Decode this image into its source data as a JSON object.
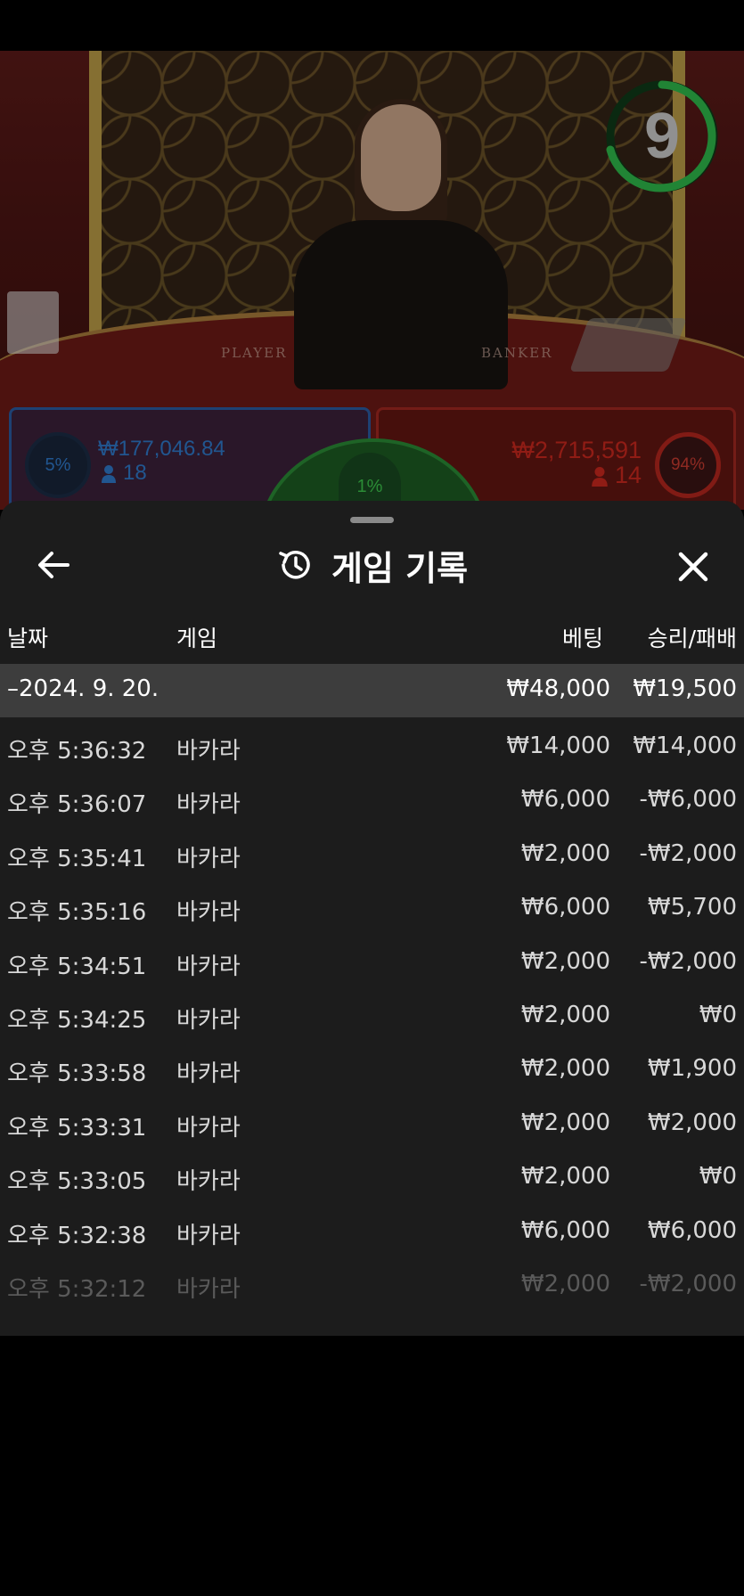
{
  "scene": {
    "timer": "9",
    "table_labels": [
      "PLAYER",
      "BANKER"
    ],
    "player": {
      "percent": "5%",
      "amount": "₩177,046.84",
      "count": "18"
    },
    "tie": {
      "percent": "1%"
    },
    "banker": {
      "percent": "94%",
      "amount": "₩2,715,591",
      "count": "14"
    }
  },
  "sheet": {
    "title": "게임 기록",
    "back_icon": "arrow-left-icon",
    "history_icon": "history-icon",
    "close_icon": "close-icon",
    "columns": {
      "date": "날짜",
      "game": "게임",
      "bet": "베팅",
      "win_loss": "승리/패배"
    },
    "date_group": {
      "label": "–2024. 9. 20.",
      "bet": "₩48,000",
      "win_loss": "₩19,500"
    },
    "rows": [
      {
        "time": "오후 5:36:32",
        "game": "바카라",
        "bet": "₩14,000",
        "win_loss": "₩14,000"
      },
      {
        "time": "오후 5:36:07",
        "game": "바카라",
        "bet": "₩6,000",
        "win_loss": "-₩6,000"
      },
      {
        "time": "오후 5:35:41",
        "game": "바카라",
        "bet": "₩2,000",
        "win_loss": "-₩2,000"
      },
      {
        "time": "오후 5:35:16",
        "game": "바카라",
        "bet": "₩6,000",
        "win_loss": "₩5,700"
      },
      {
        "time": "오후 5:34:51",
        "game": "바카라",
        "bet": "₩2,000",
        "win_loss": "-₩2,000"
      },
      {
        "time": "오후 5:34:25",
        "game": "바카라",
        "bet": "₩2,000",
        "win_loss": "₩0"
      },
      {
        "time": "오후 5:33:58",
        "game": "바카라",
        "bet": "₩2,000",
        "win_loss": "₩1,900"
      },
      {
        "time": "오후 5:33:31",
        "game": "바카라",
        "bet": "₩2,000",
        "win_loss": "₩2,000"
      },
      {
        "time": "오후 5:33:05",
        "game": "바카라",
        "bet": "₩2,000",
        "win_loss": "₩0"
      },
      {
        "time": "오후 5:32:38",
        "game": "바카라",
        "bet": "₩6,000",
        "win_loss": "₩6,000"
      },
      {
        "time": "오후 5:32:12",
        "game": "바카라",
        "bet": "₩2,000",
        "win_loss": "-₩2,000"
      }
    ]
  }
}
